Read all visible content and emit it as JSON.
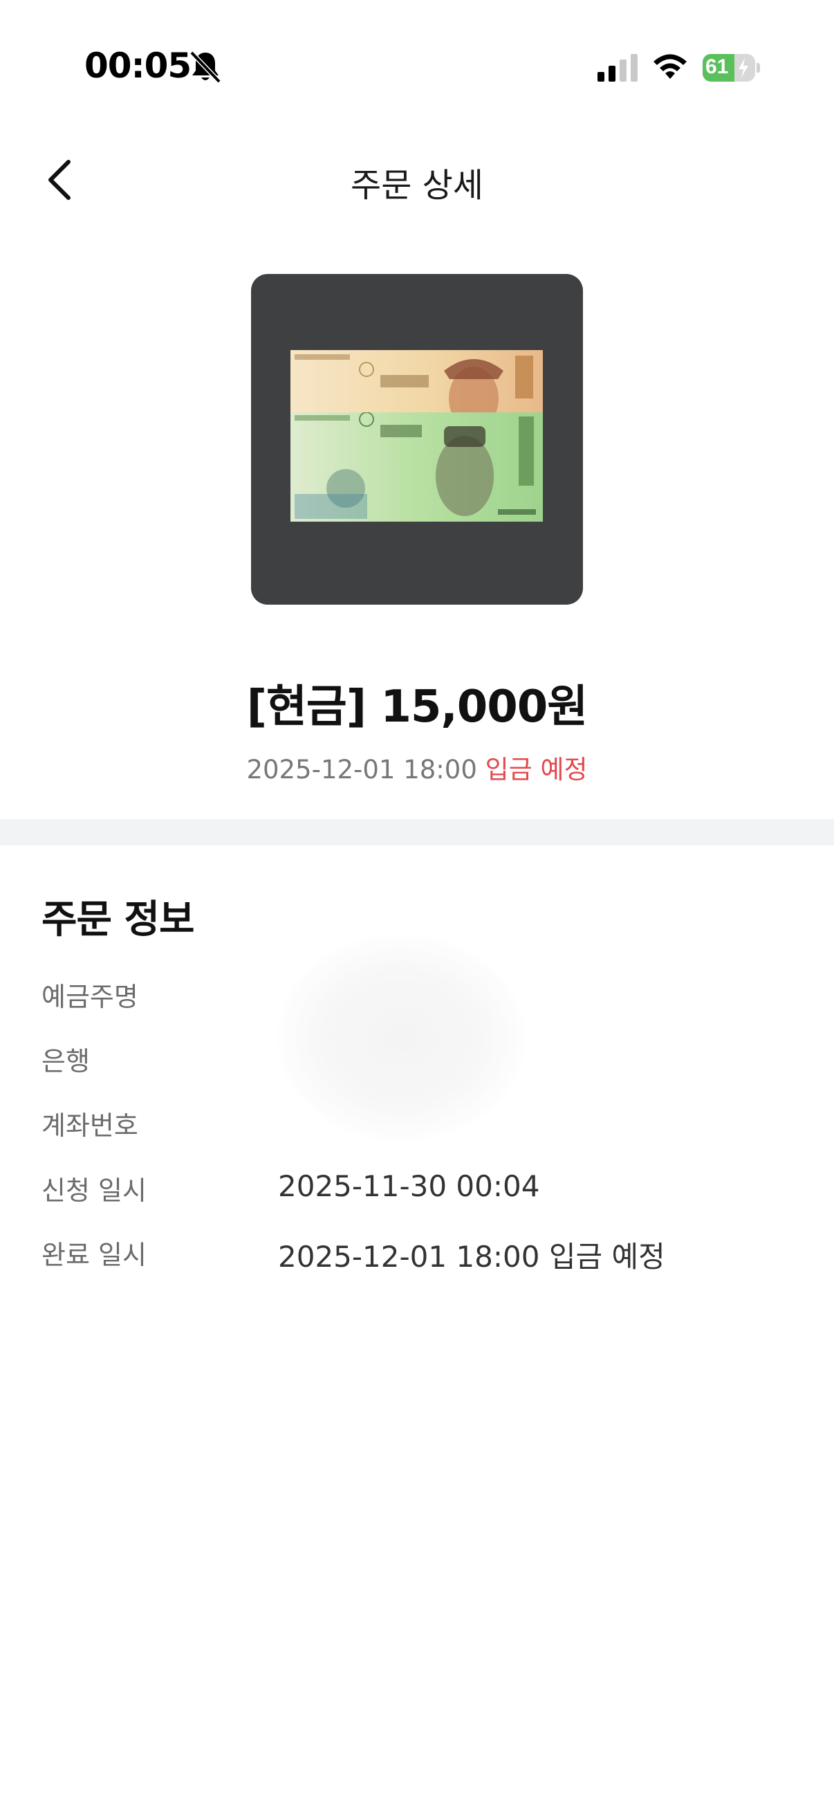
{
  "status_bar": {
    "time": "00:05",
    "battery_level": "61",
    "battery_fraction": 0.61,
    "icons": [
      "bell-slash-icon",
      "cellular-signal-icon",
      "wifi-icon",
      "battery-charging-icon"
    ]
  },
  "nav": {
    "title": "주문 상세",
    "back_icon": "chevron-left-icon"
  },
  "product": {
    "image_label": "Korean won banknotes (5,000 and 10,000)",
    "title": "[현금] 15,000원",
    "datetime": "2025-12-01 18:00",
    "status": "입금 예정"
  },
  "order_info": {
    "title": "주문 정보",
    "rows": [
      {
        "label": "예금주명",
        "value": ""
      },
      {
        "label": "은행",
        "value": ""
      },
      {
        "label": "계좌번호",
        "value": ""
      },
      {
        "label": "신청 일시",
        "value": "2025-11-30 00:04"
      },
      {
        "label": "완료 일시",
        "value": "2025-12-01 18:00 입금 예정"
      }
    ]
  },
  "colors": {
    "accent_status": "#e5484d",
    "divider": "#f2f3f5",
    "image_bg": "#3f4042",
    "battery": "#5ac05c"
  }
}
